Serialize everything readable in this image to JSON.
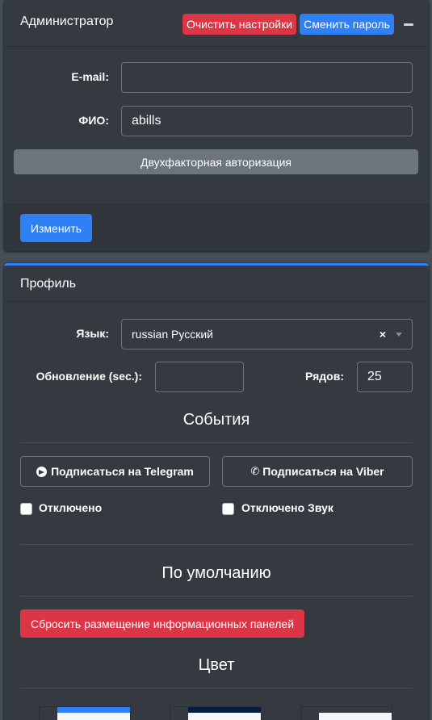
{
  "admin": {
    "title": "Администратор",
    "clear_settings_label": "Очистить настройки",
    "change_password_label": "Сменить пароль",
    "collapse_icon": "minus-icon",
    "email_label": "E-mail:",
    "email_value": "",
    "fio_label": "ФИО:",
    "fio_value": "abills",
    "twofa_label": "Двухфакторная авторизация",
    "change_label": "Изменить"
  },
  "profile": {
    "title": "Профиль",
    "language_label": "Язык:",
    "language_value": "russian Русский",
    "clear_icon": "×",
    "refresh_label": "Обновление (sec.):",
    "refresh_value": "",
    "rows_label": "Рядов:",
    "rows_value": "25",
    "events_title": "События",
    "telegram_label": "Подписаться на Telegram",
    "viber_label": "Подписаться на Viber",
    "disabled_label": "Отключено",
    "disabled_sound_label": "Отключено Звук",
    "default_title": "По умолчанию",
    "reset_panels_label": "Сбросить размещение информационных панелей",
    "color_title": "Цвет",
    "swatches": [
      {
        "name": "primary",
        "color": "#2f7ff5"
      },
      {
        "name": "navy",
        "color": "#001f3f"
      },
      {
        "name": "dark",
        "color": "#343a40"
      }
    ]
  },
  "colors": {
    "page_bg": "#454d55",
    "card_bg": "#343a40",
    "primary": "#2f7ff5",
    "danger": "#dc3545",
    "secondary": "#6c757d"
  }
}
